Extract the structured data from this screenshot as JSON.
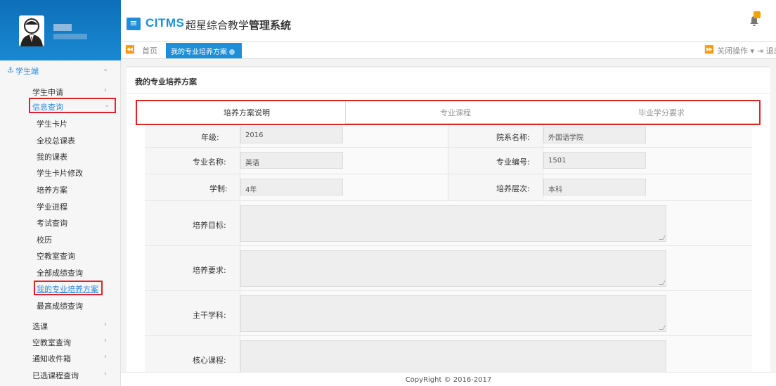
{
  "app": {
    "logo": "ITMS",
    "title_prefix": "超星综合教学",
    "title_bold": "管理系统"
  },
  "tabs": {
    "home": "首页",
    "active": "我的专业培养方案",
    "close_ops": "关闭操作",
    "logout": "退出"
  },
  "sidebar": {
    "group_label": "学生端",
    "items": [
      {
        "label": "学生申请"
      },
      {
        "label": "信息查询"
      },
      {
        "label": "学生卡片"
      },
      {
        "label": "全校总课表"
      },
      {
        "label": "我的课表"
      },
      {
        "label": "学生卡片修改"
      },
      {
        "label": "培养方案"
      },
      {
        "label": "学业进程"
      },
      {
        "label": "考试查询"
      },
      {
        "label": "校历"
      },
      {
        "label": "空教室查询"
      },
      {
        "label": "全部成绩查询"
      },
      {
        "label": "我的专业培养方案"
      },
      {
        "label": "最高成绩查询"
      },
      {
        "label": "选课"
      },
      {
        "label": "空教室查询"
      },
      {
        "label": "通知收件箱"
      },
      {
        "label": "已选课程查询"
      }
    ]
  },
  "panel": {
    "title": "我的专业培养方案",
    "tabs": [
      "培养方案说明",
      "专业课程",
      "毕业学分要求"
    ]
  },
  "form": {
    "grade_label": "年级:",
    "grade_value": "2016",
    "dept_label": "院系名称:",
    "dept_value": "外国语学院",
    "major_label": "专业名称:",
    "major_value": "英语",
    "major_no_label": "专业编号:",
    "major_no_value": "1501",
    "duration_label": "学制:",
    "duration_value": "4年",
    "level_label": "培养层次:",
    "level_value": "本科",
    "goal_label": "培养目标:",
    "req_label": "培养要求:",
    "subjects_label": "主干学科:",
    "core_label": "核心课程:"
  },
  "footer": {
    "copyright": "CopyRight © 2016-2017"
  },
  "colors": {
    "brand": "#1e8fd6",
    "highlight": "#e0232a",
    "badge": "#f0a400"
  }
}
